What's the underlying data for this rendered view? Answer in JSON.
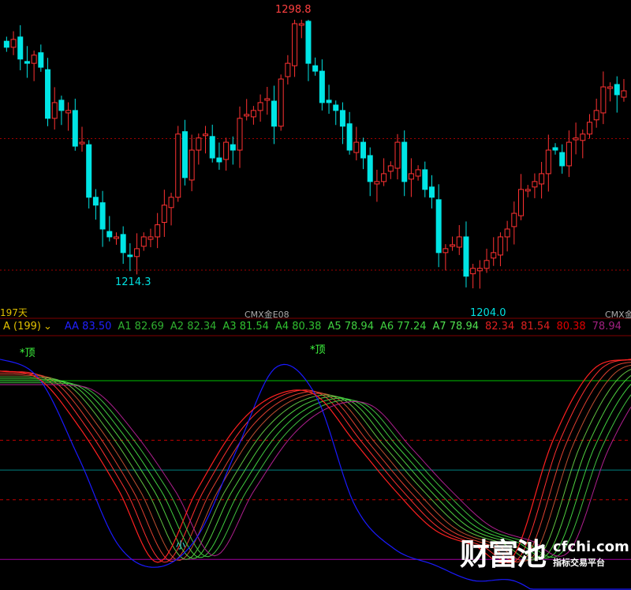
{
  "chart_data": [
    {
      "type": "candlestick",
      "title": "",
      "closes": [
        1289.7,
        1292.3,
        1285.8,
        1284.4,
        1287.1,
        1283.1,
        1266.2,
        1271.4,
        1268.8,
        1268.8,
        1257.0,
        1258.3,
        1240.1,
        1237.5,
        1229.6,
        1227.0,
        1227.0,
        1221.8,
        1220.5,
        1223.1,
        1227.0,
        1227.0,
        1231.0,
        1237.5,
        1240.1,
        1261.0,
        1246.6,
        1255.7,
        1259.7,
        1261.0,
        1253.1,
        1251.8,
        1258.3,
        1255.7,
        1266.2,
        1267.5,
        1268.8,
        1271.4,
        1272.7,
        1263.6,
        1279.2,
        1284.4,
        1297.5,
        1297.5,
        1284.4,
        1281.8,
        1271.4,
        1271.4,
        1268.8,
        1263.6,
        1255.7,
        1258.3,
        1253.1,
        1245.3,
        1245.3,
        1247.9,
        1250.5,
        1258.3,
        1245.3,
        1247.9,
        1249.2,
        1242.7,
        1240.1,
        1221.8,
        1223.1,
        1224.4,
        1227.0,
        1214.0,
        1216.6,
        1216.6,
        1219.2,
        1221.8,
        1227.0,
        1229.6,
        1234.8,
        1242.7,
        1242.7,
        1245.3,
        1247.9,
        1255.7,
        1255.7,
        1250.5,
        1258.3,
        1259.7,
        1261.0,
        1264.9,
        1268.8,
        1276.6,
        1276.6,
        1274.0,
        1275.3
      ],
      "ylim": [
        1204.0,
        1298.8
      ],
      "annotations": {
        "high": "1298.8",
        "low_left": "1214.3",
        "low_right": "1204.0"
      },
      "reference_lines": [
        1259.5,
        1216.0
      ],
      "colors": {
        "up": "#ff3232",
        "down": "#00e5e5"
      }
    },
    {
      "type": "line",
      "title": "",
      "x": [
        0,
        1,
        2,
        3,
        4,
        5,
        6,
        7,
        8,
        9,
        10,
        11,
        12,
        13,
        14,
        15,
        16
      ],
      "ylim": [
        0,
        100
      ],
      "series": [
        {
          "name": "AA",
          "color": "#1a1aff",
          "values": [
            87.2,
            80.5,
            54,
            24.8,
            17.4,
            27.5,
            56.7,
            84.5,
            75.2,
            38.1,
            23.5,
            18.2,
            12.9,
            12.9,
            6.3,
            6.3,
            6.3
          ]
        },
        {
          "name": "",
          "color": "#ff2020",
          "values": [
            83.2,
            80.5,
            64.6,
            43.4,
            19,
            43.4,
            64.6,
            75.2,
            75.2,
            59.3,
            43.4,
            30.1,
            24.8,
            20.8,
            59.3,
            83.2,
            87.2
          ]
        }
      ],
      "hlines": [
        {
          "value": 80,
          "color": "#00c000",
          "style": "solid"
        },
        {
          "value": 60,
          "color": "#c00000",
          "style": "dashed"
        },
        {
          "value": 50,
          "color": "#008080",
          "style": "solid"
        },
        {
          "value": 40,
          "color": "#c00000",
          "style": "dashed"
        },
        {
          "value": 20,
          "color": "#a000a0",
          "style": "solid"
        }
      ],
      "markers": {
        "top1": "*顶",
        "top2": "*顶",
        "bottom": "小"
      }
    }
  ],
  "axis": {
    "days": "197天",
    "contract1": "CMX金E08",
    "contract2": "CMX金"
  },
  "legend": [
    {
      "text": "A (199)",
      "color": "#e0c000"
    },
    {
      "text": "AA 83.50",
      "color": "#2020ff"
    },
    {
      "text": "A1 82.69",
      "color": "#30b030"
    },
    {
      "text": "A2 82.34",
      "color": "#30b030"
    },
    {
      "text": "A3 81.54",
      "color": "#30c030"
    },
    {
      "text": "A4 80.38",
      "color": "#30c030"
    },
    {
      "text": "A5 78.94",
      "color": "#40d040"
    },
    {
      "text": "A6 77.24",
      "color": "#40d040"
    },
    {
      "text": "A7 78.94",
      "color": "#50e050"
    },
    {
      "text": "82.34",
      "color": "#e02020"
    },
    {
      "text": "81.54",
      "color": "#e02020"
    },
    {
      "text": "80.38",
      "color": "#e00000"
    },
    {
      "text": "78.94",
      "color": "#a02080"
    }
  ],
  "watermark": {
    "brand": "财富池",
    "domain": "cfchi.com",
    "tagline": "指标交易平台"
  }
}
